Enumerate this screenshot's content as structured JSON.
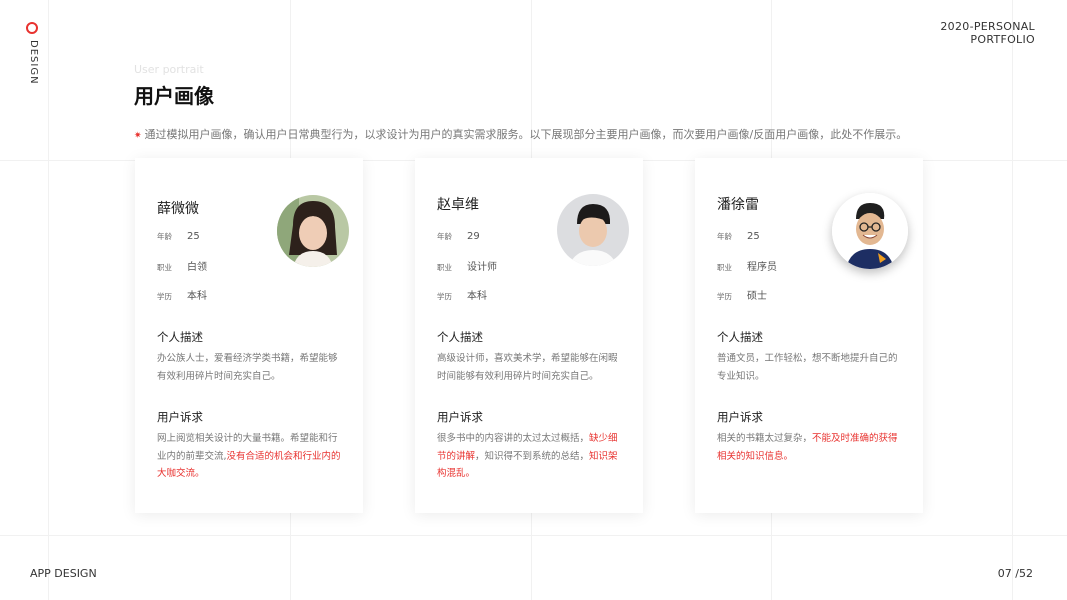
{
  "side_label": "DESIGN",
  "header": {
    "line1": "2020-PERSONAL",
    "line2": "PORTFOLIO"
  },
  "footer": {
    "left": "APP DESIGN",
    "page": "07 /52"
  },
  "section": {
    "eyebrow": "User portrait",
    "title": "用户画像",
    "intro_mark": "✷",
    "intro": "通过模拟用户画像，确认用户日常典型行为，以求设计为用户的真实需求服务。以下展现部分主要用户画像，而次要用户画像/反面用户画像，此处不作展示。"
  },
  "labels": {
    "age": "年龄",
    "job": "职业",
    "edu": "学历",
    "desc": "个人描述",
    "needs": "用户诉求"
  },
  "cards": [
    {
      "name": "薛微微",
      "age": "25",
      "job": "白领",
      "edu": "本科",
      "desc": "办公族人士，爱看经济学类书籍，希望能够有效利用碎片时间充实自己。",
      "needs_plain": "网上阅览相关设计的大量书籍。希望能和行业内的前辈交流,",
      "needs_red": "没有合适的机会和行业内的大咖交流。",
      "needs_tail": ""
    },
    {
      "name": "赵卓维",
      "age": "29",
      "job": "设计师",
      "edu": "本科",
      "desc": "高级设计师，喜欢美术学，希望能够在闲暇时间能够有效利用碎片时间充实自己。",
      "needs_plain": "很多书中的内容讲的太过太过概括，",
      "needs_red": "缺少细节的讲解",
      "needs_tail": "，知识得不到系统的总结，",
      "needs_red2": "知识架构混乱。"
    },
    {
      "name": "潘徐雷",
      "age": "25",
      "job": "程序员",
      "edu": "硕士",
      "desc": "普通文员，工作轻松，想不断地提升自己的专业知识。",
      "needs_plain": "相关的书籍太过复杂，",
      "needs_red": "不能及时准确的获得相关的知识信息。",
      "needs_tail": ""
    }
  ],
  "colors": {
    "accent": "#e8322f"
  }
}
